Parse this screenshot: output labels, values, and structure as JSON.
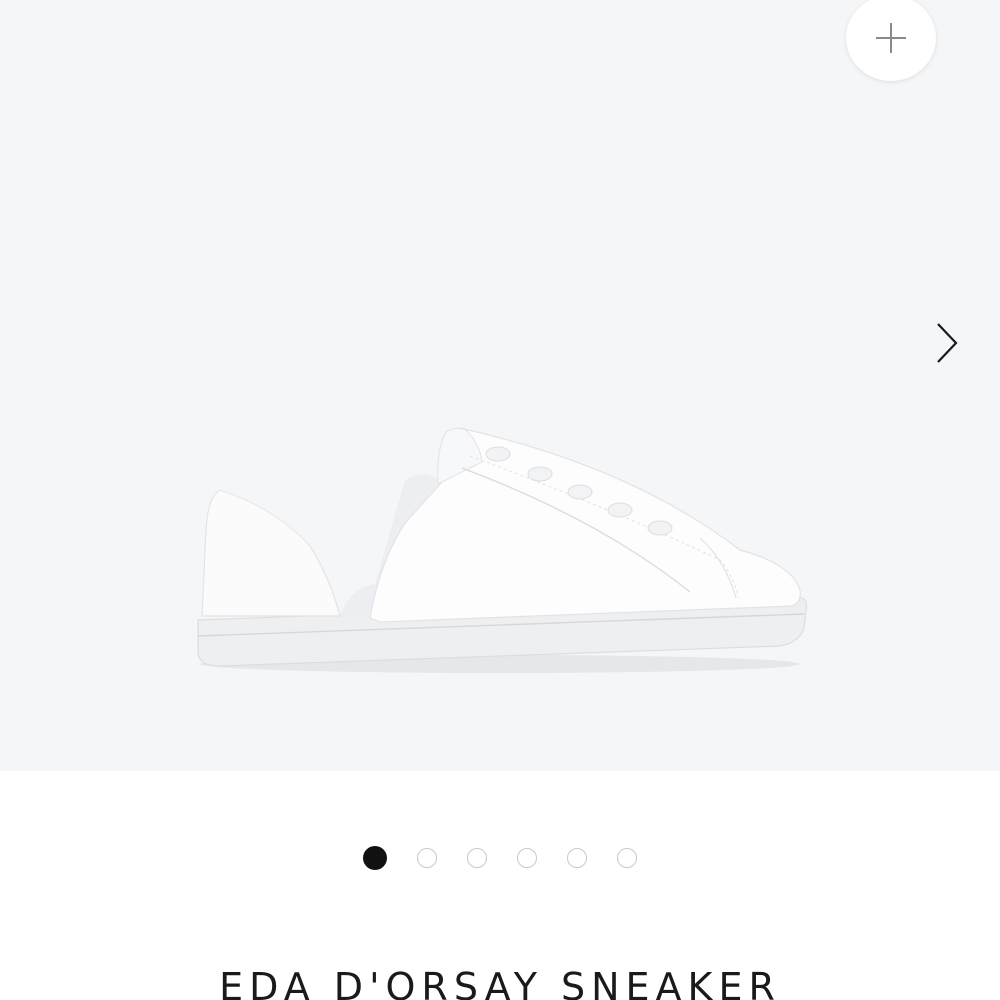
{
  "product": {
    "title": "EDA D'ORSAY SNEAKER",
    "image_alt": "White leather d'orsay sneaker"
  },
  "gallery": {
    "zoom_icon": "plus-icon",
    "next_icon": "chevron-right-icon",
    "slide_count": 6,
    "active_slide": 1,
    "background_color": "#f5f6f8"
  },
  "colors": {
    "active_dot": "#111111",
    "inactive_dot_border": "#c9c9c9",
    "title_text": "#1a1a1a"
  }
}
